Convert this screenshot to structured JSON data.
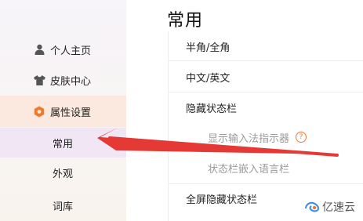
{
  "sidebar": {
    "items": [
      {
        "label": "个人主页",
        "icon": "person-icon"
      },
      {
        "label": "皮肤中心",
        "icon": "shirt-icon"
      },
      {
        "label": "属性设置",
        "icon": "hexagon-settings-icon"
      }
    ],
    "subitems": [
      {
        "label": "常用"
      },
      {
        "label": "外观"
      },
      {
        "label": "词库"
      }
    ]
  },
  "main": {
    "title": "常用",
    "rows": [
      {
        "label": "半角/全角"
      },
      {
        "label": "中文/英文"
      },
      {
        "label": "隐藏状态栏"
      },
      {
        "label": "显示输入法指示器"
      },
      {
        "label": "状态栏嵌入语言栏"
      },
      {
        "label": "全屏隐藏状态栏"
      }
    ],
    "help_symbol": "?"
  },
  "watermark": {
    "text": "亿速云"
  },
  "colors": {
    "accent": "#f07a2c",
    "arrow": "#e53935",
    "active_bg": "#fbe9e0"
  }
}
